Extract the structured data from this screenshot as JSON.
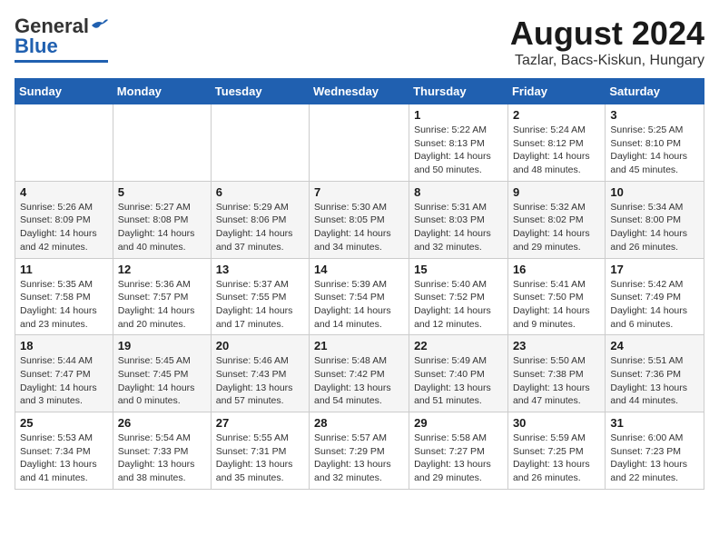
{
  "header": {
    "logo_general": "General",
    "logo_blue": "Blue",
    "main_title": "August 2024",
    "sub_title": "Tazlar, Bacs-Kiskun, Hungary"
  },
  "weekdays": [
    "Sunday",
    "Monday",
    "Tuesday",
    "Wednesday",
    "Thursday",
    "Friday",
    "Saturday"
  ],
  "weeks": [
    {
      "days": [
        {
          "num": "",
          "info": ""
        },
        {
          "num": "",
          "info": ""
        },
        {
          "num": "",
          "info": ""
        },
        {
          "num": "",
          "info": ""
        },
        {
          "num": "1",
          "info": "Sunrise: 5:22 AM\nSunset: 8:13 PM\nDaylight: 14 hours and 50 minutes."
        },
        {
          "num": "2",
          "info": "Sunrise: 5:24 AM\nSunset: 8:12 PM\nDaylight: 14 hours and 48 minutes."
        },
        {
          "num": "3",
          "info": "Sunrise: 5:25 AM\nSunset: 8:10 PM\nDaylight: 14 hours and 45 minutes."
        }
      ]
    },
    {
      "days": [
        {
          "num": "4",
          "info": "Sunrise: 5:26 AM\nSunset: 8:09 PM\nDaylight: 14 hours and 42 minutes."
        },
        {
          "num": "5",
          "info": "Sunrise: 5:27 AM\nSunset: 8:08 PM\nDaylight: 14 hours and 40 minutes."
        },
        {
          "num": "6",
          "info": "Sunrise: 5:29 AM\nSunset: 8:06 PM\nDaylight: 14 hours and 37 minutes."
        },
        {
          "num": "7",
          "info": "Sunrise: 5:30 AM\nSunset: 8:05 PM\nDaylight: 14 hours and 34 minutes."
        },
        {
          "num": "8",
          "info": "Sunrise: 5:31 AM\nSunset: 8:03 PM\nDaylight: 14 hours and 32 minutes."
        },
        {
          "num": "9",
          "info": "Sunrise: 5:32 AM\nSunset: 8:02 PM\nDaylight: 14 hours and 29 minutes."
        },
        {
          "num": "10",
          "info": "Sunrise: 5:34 AM\nSunset: 8:00 PM\nDaylight: 14 hours and 26 minutes."
        }
      ]
    },
    {
      "days": [
        {
          "num": "11",
          "info": "Sunrise: 5:35 AM\nSunset: 7:58 PM\nDaylight: 14 hours and 23 minutes."
        },
        {
          "num": "12",
          "info": "Sunrise: 5:36 AM\nSunset: 7:57 PM\nDaylight: 14 hours and 20 minutes."
        },
        {
          "num": "13",
          "info": "Sunrise: 5:37 AM\nSunset: 7:55 PM\nDaylight: 14 hours and 17 minutes."
        },
        {
          "num": "14",
          "info": "Sunrise: 5:39 AM\nSunset: 7:54 PM\nDaylight: 14 hours and 14 minutes."
        },
        {
          "num": "15",
          "info": "Sunrise: 5:40 AM\nSunset: 7:52 PM\nDaylight: 14 hours and 12 minutes."
        },
        {
          "num": "16",
          "info": "Sunrise: 5:41 AM\nSunset: 7:50 PM\nDaylight: 14 hours and 9 minutes."
        },
        {
          "num": "17",
          "info": "Sunrise: 5:42 AM\nSunset: 7:49 PM\nDaylight: 14 hours and 6 minutes."
        }
      ]
    },
    {
      "days": [
        {
          "num": "18",
          "info": "Sunrise: 5:44 AM\nSunset: 7:47 PM\nDaylight: 14 hours and 3 minutes."
        },
        {
          "num": "19",
          "info": "Sunrise: 5:45 AM\nSunset: 7:45 PM\nDaylight: 14 hours and 0 minutes."
        },
        {
          "num": "20",
          "info": "Sunrise: 5:46 AM\nSunset: 7:43 PM\nDaylight: 13 hours and 57 minutes."
        },
        {
          "num": "21",
          "info": "Sunrise: 5:48 AM\nSunset: 7:42 PM\nDaylight: 13 hours and 54 minutes."
        },
        {
          "num": "22",
          "info": "Sunrise: 5:49 AM\nSunset: 7:40 PM\nDaylight: 13 hours and 51 minutes."
        },
        {
          "num": "23",
          "info": "Sunrise: 5:50 AM\nSunset: 7:38 PM\nDaylight: 13 hours and 47 minutes."
        },
        {
          "num": "24",
          "info": "Sunrise: 5:51 AM\nSunset: 7:36 PM\nDaylight: 13 hours and 44 minutes."
        }
      ]
    },
    {
      "days": [
        {
          "num": "25",
          "info": "Sunrise: 5:53 AM\nSunset: 7:34 PM\nDaylight: 13 hours and 41 minutes."
        },
        {
          "num": "26",
          "info": "Sunrise: 5:54 AM\nSunset: 7:33 PM\nDaylight: 13 hours and 38 minutes."
        },
        {
          "num": "27",
          "info": "Sunrise: 5:55 AM\nSunset: 7:31 PM\nDaylight: 13 hours and 35 minutes."
        },
        {
          "num": "28",
          "info": "Sunrise: 5:57 AM\nSunset: 7:29 PM\nDaylight: 13 hours and 32 minutes."
        },
        {
          "num": "29",
          "info": "Sunrise: 5:58 AM\nSunset: 7:27 PM\nDaylight: 13 hours and 29 minutes."
        },
        {
          "num": "30",
          "info": "Sunrise: 5:59 AM\nSunset: 7:25 PM\nDaylight: 13 hours and 26 minutes."
        },
        {
          "num": "31",
          "info": "Sunrise: 6:00 AM\nSunset: 7:23 PM\nDaylight: 13 hours and 22 minutes."
        }
      ]
    }
  ]
}
